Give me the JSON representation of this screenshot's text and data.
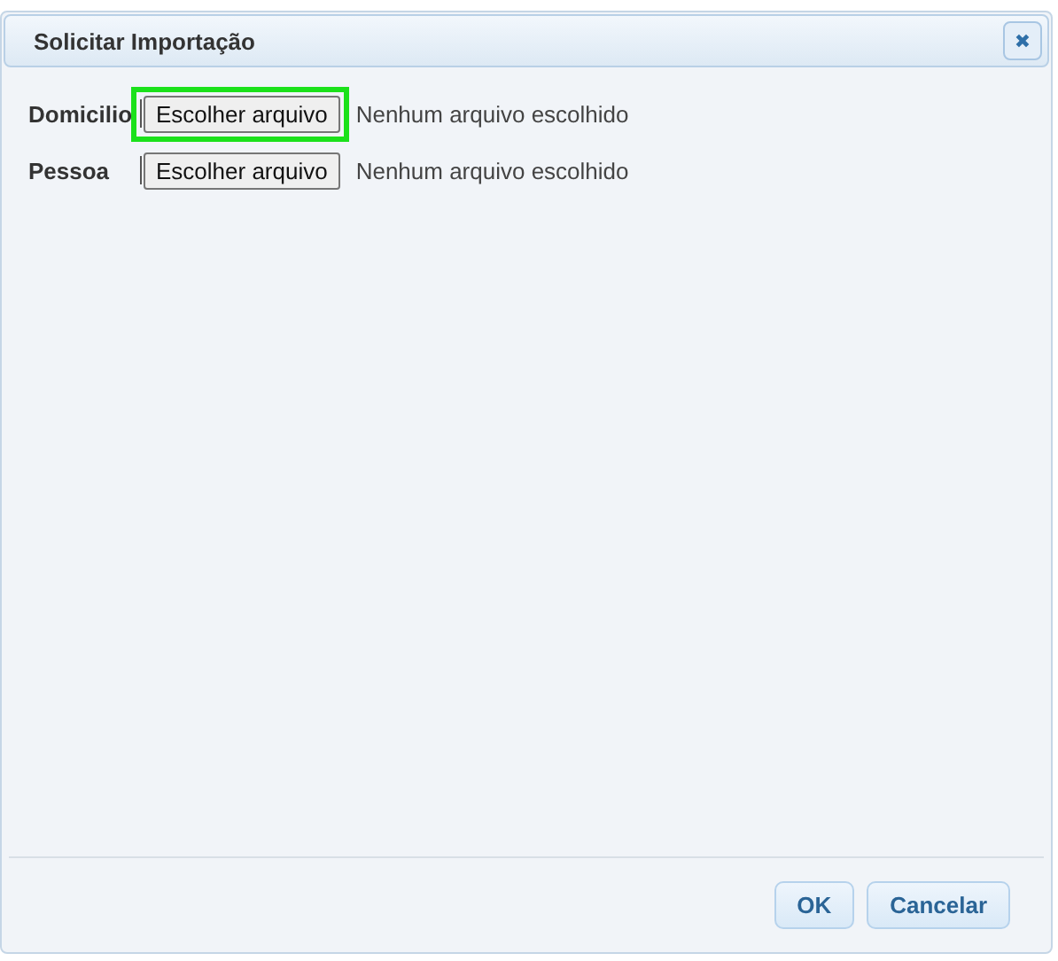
{
  "window": {
    "title": "Solicitar Importação",
    "close_icon": "✖"
  },
  "fields": [
    {
      "label": "Domicilio",
      "button": "Escolher arquivo",
      "status": "Nenhum arquivo escolhido",
      "focused": true
    },
    {
      "label": "Pessoa",
      "button": "Escolher arquivo",
      "status": "Nenhum arquivo escolhido",
      "focused": false
    }
  ],
  "buttons": [
    {
      "label": "OK"
    },
    {
      "label": "Cancelar"
    }
  ]
}
